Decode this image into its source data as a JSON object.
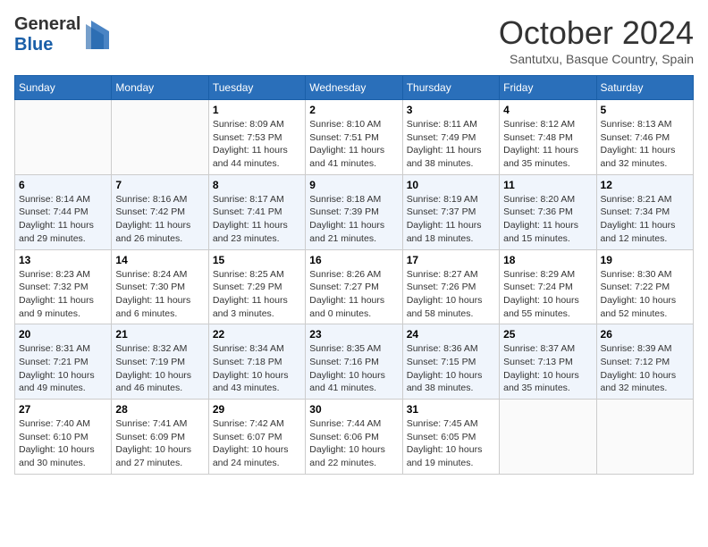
{
  "header": {
    "logo_general": "General",
    "logo_blue": "Blue",
    "month_title": "October 2024",
    "location": "Santutxu, Basque Country, Spain"
  },
  "weekdays": [
    "Sunday",
    "Monday",
    "Tuesday",
    "Wednesday",
    "Thursday",
    "Friday",
    "Saturday"
  ],
  "weeks": [
    [
      {
        "day": "",
        "detail": ""
      },
      {
        "day": "",
        "detail": ""
      },
      {
        "day": "1",
        "detail": "Sunrise: 8:09 AM\nSunset: 7:53 PM\nDaylight: 11 hours and 44 minutes."
      },
      {
        "day": "2",
        "detail": "Sunrise: 8:10 AM\nSunset: 7:51 PM\nDaylight: 11 hours and 41 minutes."
      },
      {
        "day": "3",
        "detail": "Sunrise: 8:11 AM\nSunset: 7:49 PM\nDaylight: 11 hours and 38 minutes."
      },
      {
        "day": "4",
        "detail": "Sunrise: 8:12 AM\nSunset: 7:48 PM\nDaylight: 11 hours and 35 minutes."
      },
      {
        "day": "5",
        "detail": "Sunrise: 8:13 AM\nSunset: 7:46 PM\nDaylight: 11 hours and 32 minutes."
      }
    ],
    [
      {
        "day": "6",
        "detail": "Sunrise: 8:14 AM\nSunset: 7:44 PM\nDaylight: 11 hours and 29 minutes."
      },
      {
        "day": "7",
        "detail": "Sunrise: 8:16 AM\nSunset: 7:42 PM\nDaylight: 11 hours and 26 minutes."
      },
      {
        "day": "8",
        "detail": "Sunrise: 8:17 AM\nSunset: 7:41 PM\nDaylight: 11 hours and 23 minutes."
      },
      {
        "day": "9",
        "detail": "Sunrise: 8:18 AM\nSunset: 7:39 PM\nDaylight: 11 hours and 21 minutes."
      },
      {
        "day": "10",
        "detail": "Sunrise: 8:19 AM\nSunset: 7:37 PM\nDaylight: 11 hours and 18 minutes."
      },
      {
        "day": "11",
        "detail": "Sunrise: 8:20 AM\nSunset: 7:36 PM\nDaylight: 11 hours and 15 minutes."
      },
      {
        "day": "12",
        "detail": "Sunrise: 8:21 AM\nSunset: 7:34 PM\nDaylight: 11 hours and 12 minutes."
      }
    ],
    [
      {
        "day": "13",
        "detail": "Sunrise: 8:23 AM\nSunset: 7:32 PM\nDaylight: 11 hours and 9 minutes."
      },
      {
        "day": "14",
        "detail": "Sunrise: 8:24 AM\nSunset: 7:30 PM\nDaylight: 11 hours and 6 minutes."
      },
      {
        "day": "15",
        "detail": "Sunrise: 8:25 AM\nSunset: 7:29 PM\nDaylight: 11 hours and 3 minutes."
      },
      {
        "day": "16",
        "detail": "Sunrise: 8:26 AM\nSunset: 7:27 PM\nDaylight: 11 hours and 0 minutes."
      },
      {
        "day": "17",
        "detail": "Sunrise: 8:27 AM\nSunset: 7:26 PM\nDaylight: 10 hours and 58 minutes."
      },
      {
        "day": "18",
        "detail": "Sunrise: 8:29 AM\nSunset: 7:24 PM\nDaylight: 10 hours and 55 minutes."
      },
      {
        "day": "19",
        "detail": "Sunrise: 8:30 AM\nSunset: 7:22 PM\nDaylight: 10 hours and 52 minutes."
      }
    ],
    [
      {
        "day": "20",
        "detail": "Sunrise: 8:31 AM\nSunset: 7:21 PM\nDaylight: 10 hours and 49 minutes."
      },
      {
        "day": "21",
        "detail": "Sunrise: 8:32 AM\nSunset: 7:19 PM\nDaylight: 10 hours and 46 minutes."
      },
      {
        "day": "22",
        "detail": "Sunrise: 8:34 AM\nSunset: 7:18 PM\nDaylight: 10 hours and 43 minutes."
      },
      {
        "day": "23",
        "detail": "Sunrise: 8:35 AM\nSunset: 7:16 PM\nDaylight: 10 hours and 41 minutes."
      },
      {
        "day": "24",
        "detail": "Sunrise: 8:36 AM\nSunset: 7:15 PM\nDaylight: 10 hours and 38 minutes."
      },
      {
        "day": "25",
        "detail": "Sunrise: 8:37 AM\nSunset: 7:13 PM\nDaylight: 10 hours and 35 minutes."
      },
      {
        "day": "26",
        "detail": "Sunrise: 8:39 AM\nSunset: 7:12 PM\nDaylight: 10 hours and 32 minutes."
      }
    ],
    [
      {
        "day": "27",
        "detail": "Sunrise: 7:40 AM\nSunset: 6:10 PM\nDaylight: 10 hours and 30 minutes."
      },
      {
        "day": "28",
        "detail": "Sunrise: 7:41 AM\nSunset: 6:09 PM\nDaylight: 10 hours and 27 minutes."
      },
      {
        "day": "29",
        "detail": "Sunrise: 7:42 AM\nSunset: 6:07 PM\nDaylight: 10 hours and 24 minutes."
      },
      {
        "day": "30",
        "detail": "Sunrise: 7:44 AM\nSunset: 6:06 PM\nDaylight: 10 hours and 22 minutes."
      },
      {
        "day": "31",
        "detail": "Sunrise: 7:45 AM\nSunset: 6:05 PM\nDaylight: 10 hours and 19 minutes."
      },
      {
        "day": "",
        "detail": ""
      },
      {
        "day": "",
        "detail": ""
      }
    ]
  ]
}
